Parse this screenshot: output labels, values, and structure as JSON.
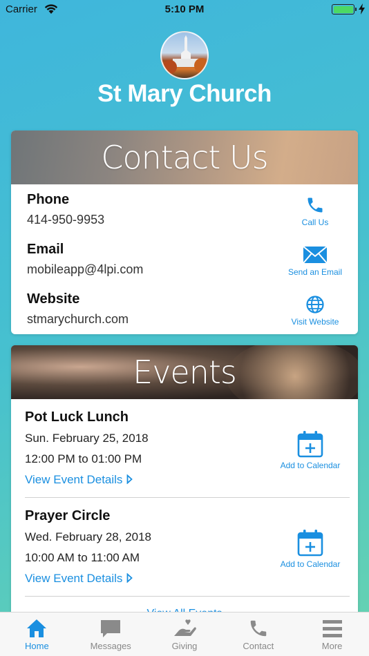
{
  "status_bar": {
    "carrier": "Carrier",
    "time": "5:10 PM",
    "battery_level": 1.0
  },
  "header": {
    "title": "St Mary Church"
  },
  "contact": {
    "banner_title": "Contact Us",
    "rows": [
      {
        "label": "Phone",
        "value": "414-950-9953",
        "action": "Call Us",
        "icon": "phone-icon"
      },
      {
        "label": "Email",
        "value": "mobileapp@4lpi.com",
        "action": "Send an Email",
        "icon": "envelope-icon"
      },
      {
        "label": "Website",
        "value": "stmarychurch.com",
        "action": "Visit Website",
        "icon": "globe-icon"
      }
    ]
  },
  "events": {
    "banner_title": "Events",
    "items": [
      {
        "title": "Pot Luck Lunch",
        "date": "Sun. February 25, 2018",
        "time": "12:00 PM to 01:00 PM",
        "link": "View Event Details",
        "action": "Add to Calendar"
      },
      {
        "title": "Prayer Circle",
        "date": "Wed. February 28, 2018",
        "time": "10:00 AM to 11:00 AM",
        "link": "View Event Details",
        "action": "Add to Calendar"
      }
    ],
    "view_all": "View All Events"
  },
  "tab_bar": {
    "tabs": [
      {
        "label": "Home",
        "icon": "home-icon",
        "active": true
      },
      {
        "label": "Messages",
        "icon": "chat-icon",
        "active": false
      },
      {
        "label": "Giving",
        "icon": "giving-hand-icon",
        "active": false
      },
      {
        "label": "Contact",
        "icon": "phone-icon",
        "active": false
      },
      {
        "label": "More",
        "icon": "menu-icon",
        "active": false
      }
    ]
  },
  "colors": {
    "accent": "#1a8fe0",
    "battery": "#4cd964"
  }
}
